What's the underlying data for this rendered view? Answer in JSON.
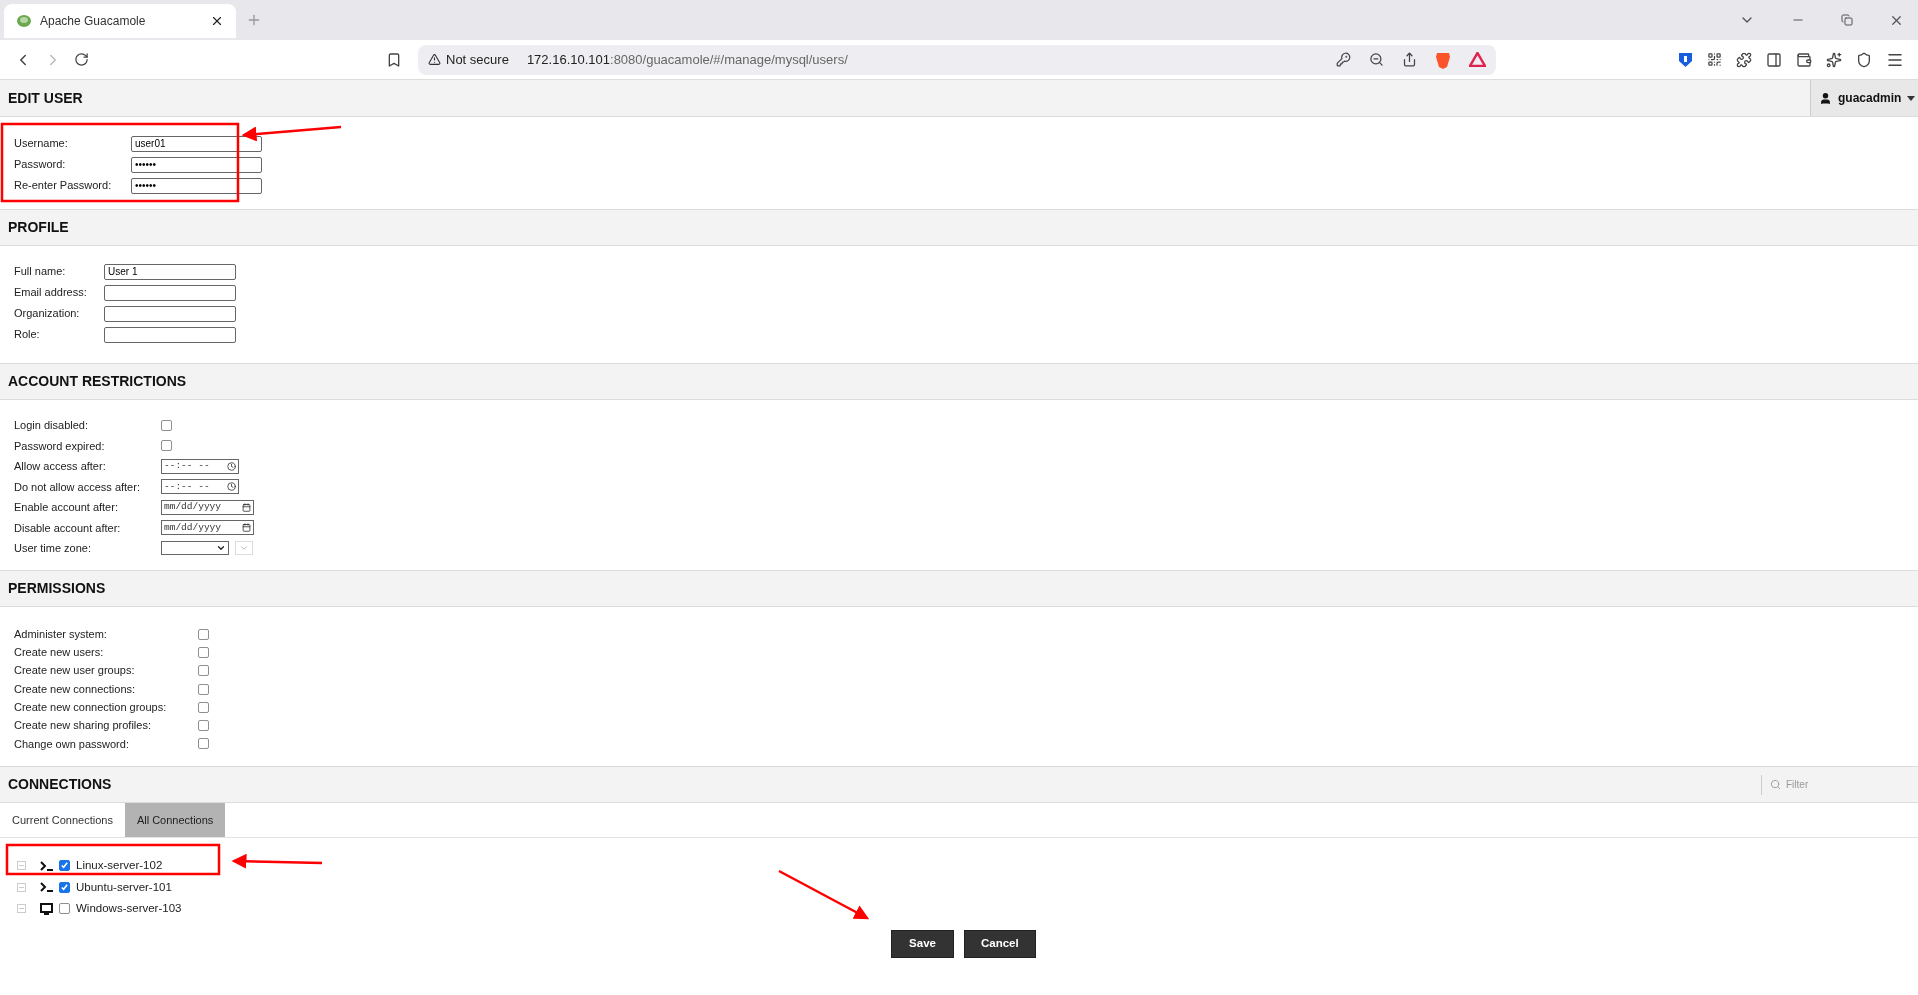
{
  "browser": {
    "tab": {
      "title": "Apache Guacamole"
    },
    "address_bar": {
      "security": "Not secure",
      "url_host": "172.16.10.101",
      "url_rest": ":8080/guacamole/#/manage/mysql/users/"
    }
  },
  "user_menu": {
    "name": "guacadmin"
  },
  "edit_user": {
    "title": "EDIT USER",
    "fields": [
      {
        "label": "Username:",
        "value": "user01"
      },
      {
        "label": "Password:",
        "value": "••••••"
      },
      {
        "label": "Re-enter Password:",
        "value": "••••••"
      }
    ]
  },
  "profile": {
    "title": "PROFILE",
    "fields": [
      {
        "label": "Full name:",
        "value": "User 1"
      },
      {
        "label": "Email address:"
      },
      {
        "label": "Organization:"
      },
      {
        "label": "Role:"
      }
    ]
  },
  "account_restrictions": {
    "title": "ACCOUNT RESTRICTIONS",
    "fields": [
      {
        "label": "Login disabled:",
        "kind": "checkbox",
        "checked": false
      },
      {
        "label": "Password expired:",
        "kind": "checkbox",
        "checked": false
      },
      {
        "label": "Allow access after:",
        "kind": "time",
        "placeholder": "--:-- --"
      },
      {
        "label": "Do not allow access after:",
        "kind": "time",
        "placeholder": "--:-- --"
      },
      {
        "label": "Enable account after:",
        "kind": "date",
        "placeholder": "mm/dd/yyyy"
      },
      {
        "label": "Disable account after:",
        "kind": "date",
        "placeholder": "mm/dd/yyyy"
      },
      {
        "label": "User time zone:",
        "kind": "select"
      }
    ]
  },
  "permissions": {
    "title": "PERMISSIONS",
    "items": [
      {
        "label": "Administer system:",
        "checked": false
      },
      {
        "label": "Create new users:",
        "checked": false
      },
      {
        "label": "Create new user groups:",
        "checked": false
      },
      {
        "label": "Create new connections:",
        "checked": false
      },
      {
        "label": "Create new connection groups:",
        "checked": false
      },
      {
        "label": "Create new sharing profiles:",
        "checked": false
      },
      {
        "label": "Change own password:",
        "checked": false
      }
    ]
  },
  "connections": {
    "title": "CONNECTIONS",
    "filter": {
      "placeholder": "Filter"
    },
    "tabs": [
      {
        "label": "Current Connections",
        "selected": false
      },
      {
        "label": "All Connections",
        "selected": true
      }
    ],
    "items": [
      {
        "name": "Linux-server-102",
        "kind": "terminal",
        "checked": true
      },
      {
        "name": "Ubuntu-server-101",
        "kind": "terminal",
        "checked": true
      },
      {
        "name": "Windows-server-103",
        "kind": "desktop",
        "checked": false
      }
    ]
  },
  "buttons": [
    {
      "label": "Save"
    },
    {
      "label": "Cancel"
    }
  ]
}
